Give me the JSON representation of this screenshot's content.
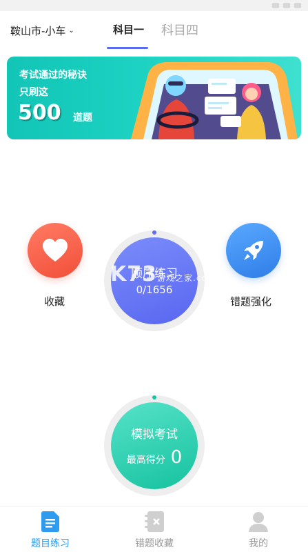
{
  "header": {
    "city": "鞍山市-小车",
    "tabs": [
      {
        "label": "科目一",
        "active": true
      },
      {
        "label": "科目四",
        "active": false
      }
    ]
  },
  "banner": {
    "line1": "考试通过的秘诀",
    "line2": "只刷这",
    "number": "500",
    "suffix": "道题"
  },
  "actions": {
    "favorites": {
      "label": "收藏",
      "icon": "heart-icon"
    },
    "wrong_drill": {
      "label": "错题强化",
      "icon": "rocket-icon"
    },
    "sequential": {
      "title": "顺序练习",
      "progress": "0/1656"
    },
    "mock_exam": {
      "title": "模拟考试",
      "best_label": "最高得分",
      "best_score": "0"
    }
  },
  "watermark": {
    "main": "K73",
    "sub": "游戏之家",
    "domain": ".com"
  },
  "tabbar": {
    "items": [
      {
        "label": "题目练习",
        "icon": "document-icon",
        "active": true
      },
      {
        "label": "错题收藏",
        "icon": "notebook-icon",
        "active": false
      },
      {
        "label": "我的",
        "icon": "user-icon",
        "active": false
      }
    ]
  },
  "colors": {
    "accent_blue": "#5b6cf2",
    "tab_active": "#2d9cf0",
    "mint": "#19c6a4",
    "coral": "#f24f3a",
    "sky": "#2f7de8"
  }
}
